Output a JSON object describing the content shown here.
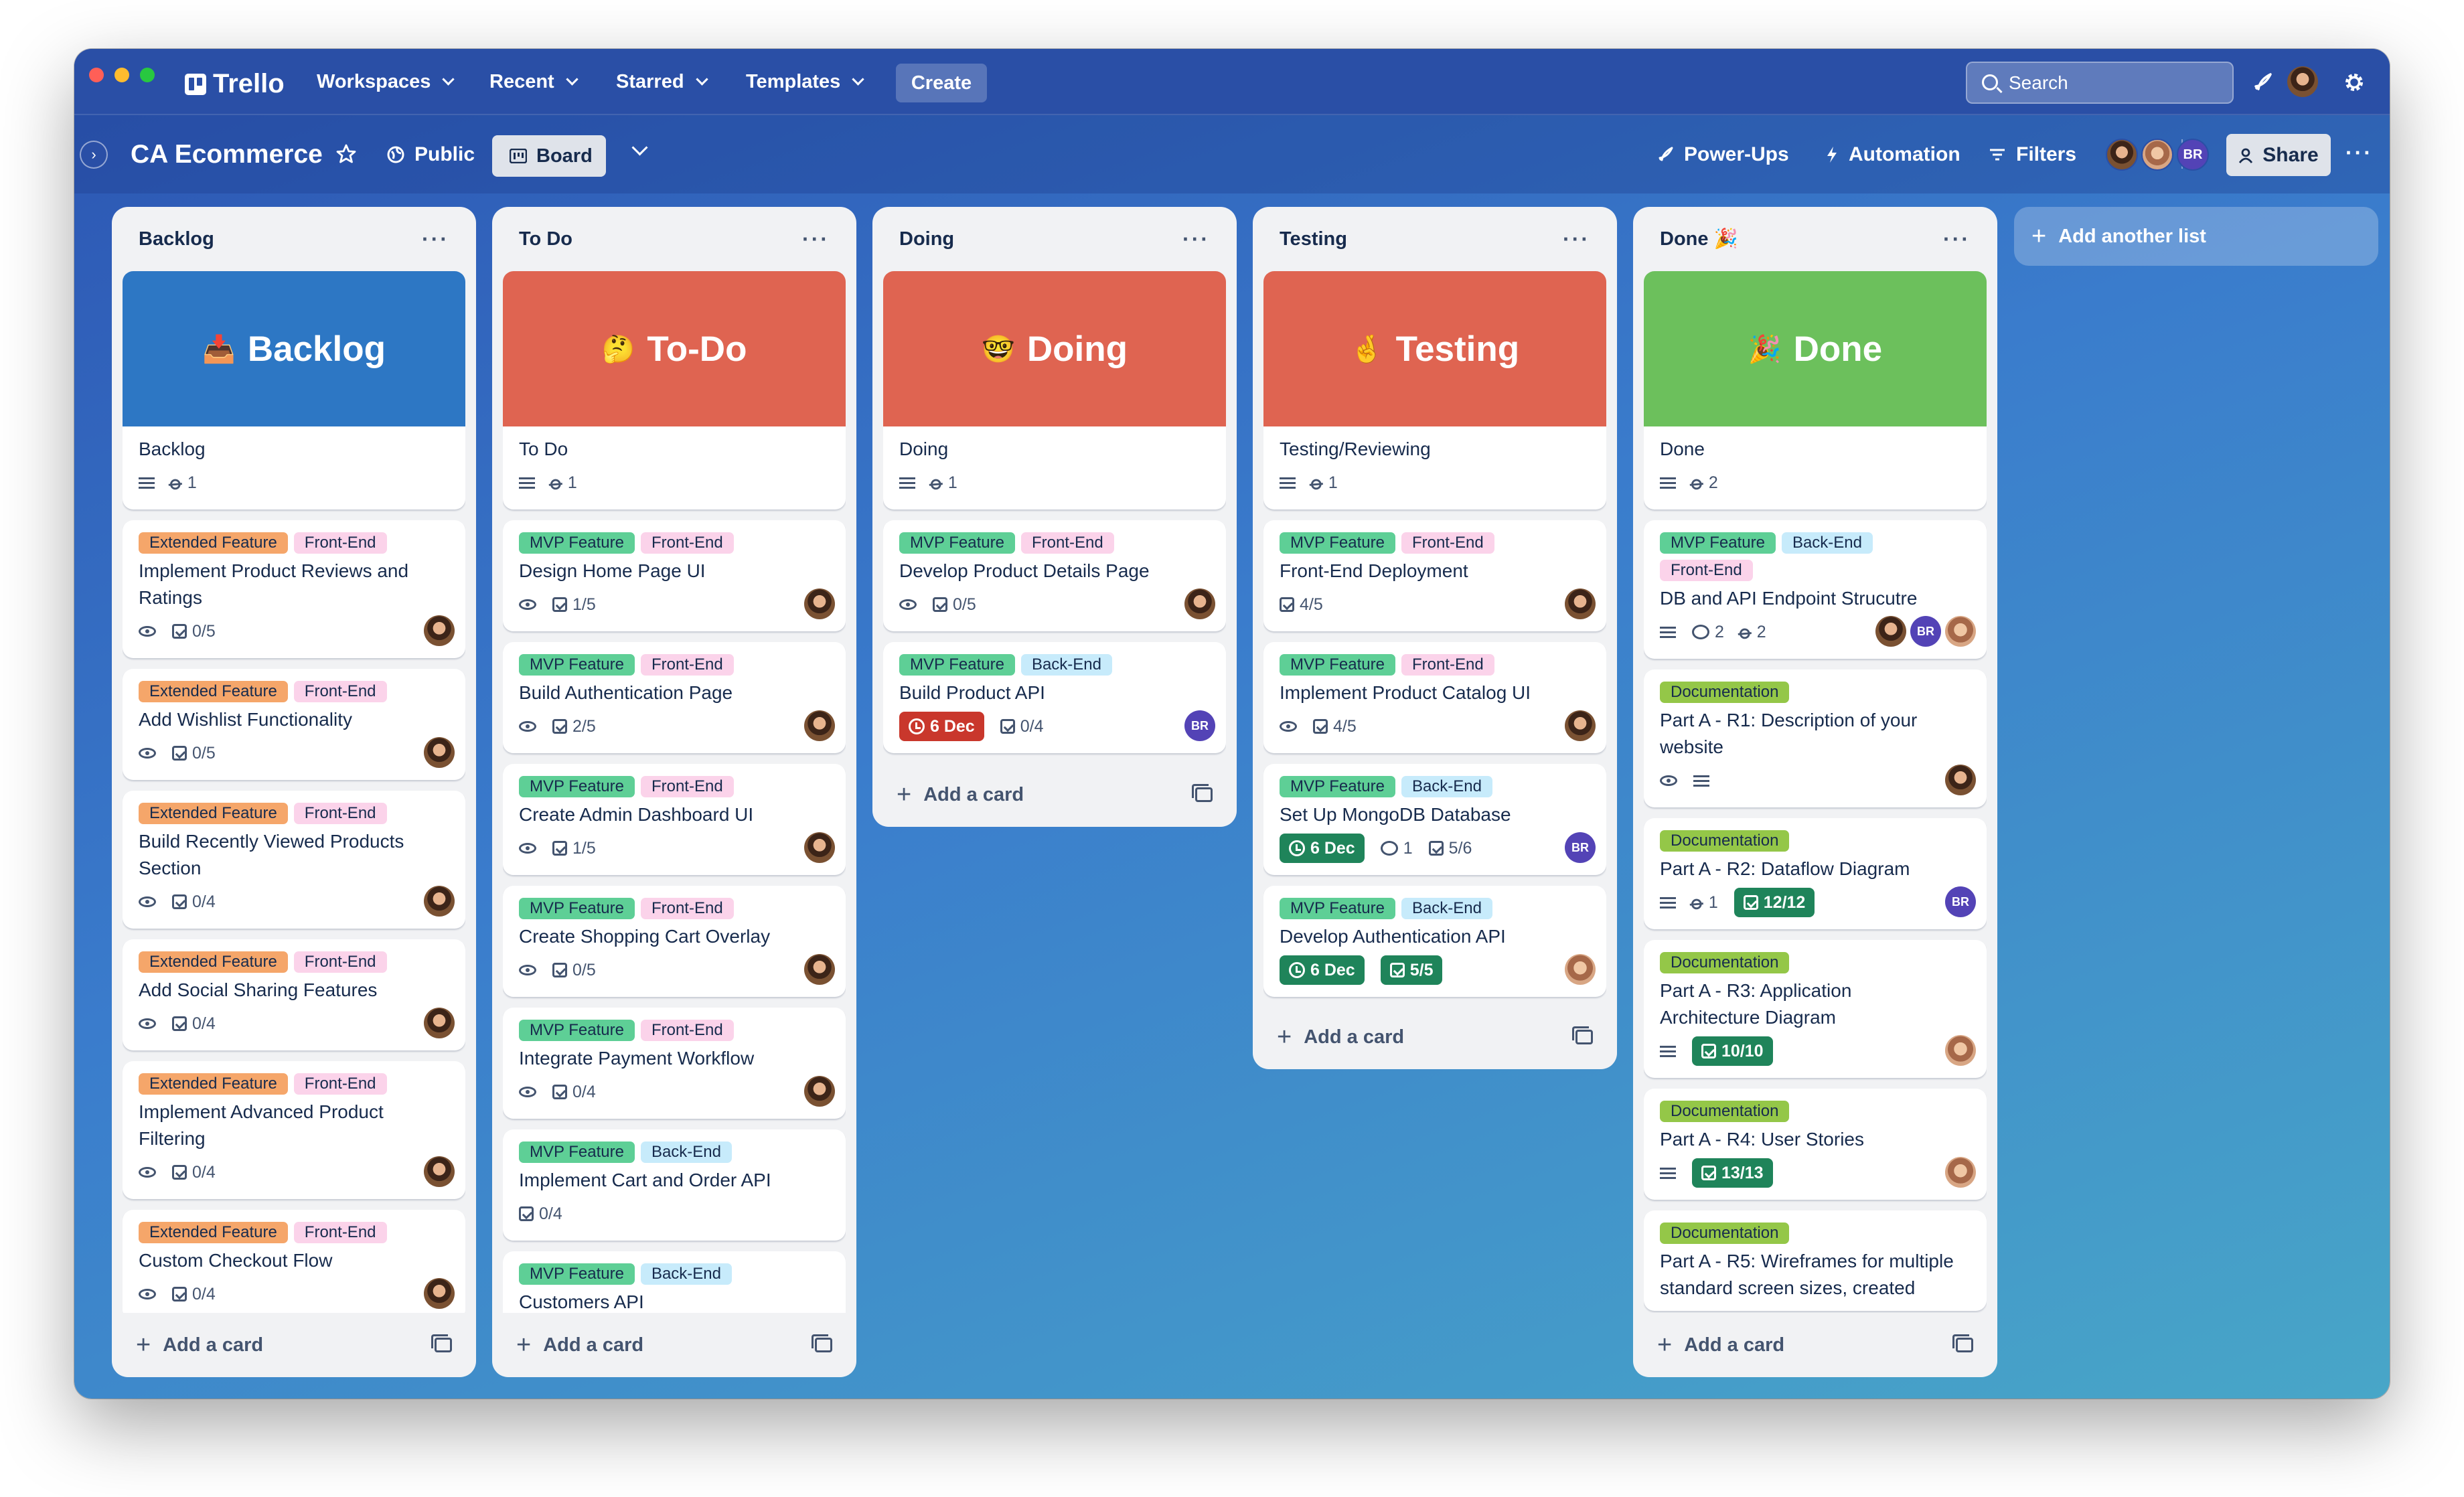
{
  "topbar": {
    "brand": "Trello",
    "nav": [
      "Workspaces",
      "Recent",
      "Starred",
      "Templates"
    ],
    "create": "Create",
    "search_placeholder": "Search"
  },
  "board": {
    "title": "CA Ecommerce",
    "visibility": "Public",
    "view": "Board",
    "powerups": "Power-Ups",
    "automation": "Automation",
    "filters": "Filters",
    "share": "Share",
    "member_initials": "BR"
  },
  "lists": [
    {
      "title": "Backlog",
      "cards": [
        {
          "cover": {
            "text": "Backlog",
            "emoji": "📥",
            "color": "#2d77c4"
          },
          "title": "Backlog",
          "badges": {
            "desc": true,
            "attach": "1"
          }
        },
        {
          "labels": [
            "Extended Feature",
            "Front-End"
          ],
          "title": [
            "Implement Product Reviews and",
            "Ratings"
          ],
          "badges": {
            "watch": true,
            "check": "0/5"
          },
          "avatars": [
            "photo"
          ]
        },
        {
          "labels": [
            "Extended Feature",
            "Front-End"
          ],
          "title": [
            "Add Wishlist Functionality"
          ],
          "badges": {
            "watch": true,
            "check": "0/5"
          },
          "avatars": [
            "photo"
          ]
        },
        {
          "labels": [
            "Extended Feature",
            "Front-End"
          ],
          "title": [
            "Build Recently Viewed Products",
            "Section"
          ],
          "badges": {
            "watch": true,
            "check": "0/4"
          },
          "avatars": [
            "photo"
          ]
        },
        {
          "labels": [
            "Extended Feature",
            "Front-End"
          ],
          "title": [
            "Add Social Sharing Features"
          ],
          "badges": {
            "watch": true,
            "check": "0/4"
          },
          "avatars": [
            "photo"
          ]
        },
        {
          "labels": [
            "Extended Feature",
            "Front-End"
          ],
          "title": [
            "Implement Advanced Product",
            "Filtering"
          ],
          "badges": {
            "watch": true,
            "check": "0/4"
          },
          "avatars": [
            "photo"
          ]
        },
        {
          "labels": [
            "Extended Feature",
            "Front-End"
          ],
          "title": [
            "Custom Checkout Flow"
          ],
          "badges": {
            "watch": true,
            "check": "0/4"
          },
          "avatars": [
            "photo"
          ]
        }
      ],
      "add": "Add a card"
    },
    {
      "title": "To Do",
      "cards": [
        {
          "cover": {
            "text": "To-Do",
            "emoji": "🤔",
            "color": "#df6451"
          },
          "title": "To Do",
          "badges": {
            "desc": true,
            "attach": "1"
          }
        },
        {
          "labels": [
            "MVP Feature",
            "Front-End"
          ],
          "title": [
            "Design Home Page UI"
          ],
          "badges": {
            "watch": true,
            "check": "1/5"
          },
          "avatars": [
            "photo"
          ]
        },
        {
          "labels": [
            "MVP Feature",
            "Front-End"
          ],
          "title": [
            "Build Authentication Page"
          ],
          "badges": {
            "watch": true,
            "check": "2/5"
          },
          "avatars": [
            "photo"
          ]
        },
        {
          "labels": [
            "MVP Feature",
            "Front-End"
          ],
          "title": [
            "Create Admin Dashboard UI"
          ],
          "badges": {
            "watch": true,
            "check": "1/5"
          },
          "avatars": [
            "photo"
          ]
        },
        {
          "labels": [
            "MVP Feature",
            "Front-End"
          ],
          "title": [
            "Create Shopping Cart Overlay"
          ],
          "badges": {
            "watch": true,
            "check": "0/5"
          },
          "avatars": [
            "photo"
          ]
        },
        {
          "labels": [
            "MVP Feature",
            "Front-End"
          ],
          "title": [
            "Integrate Payment Workflow"
          ],
          "badges": {
            "watch": true,
            "check": "0/4"
          },
          "avatars": [
            "photo"
          ]
        },
        {
          "labels": [
            "MVP Feature",
            "Back-End"
          ],
          "title": [
            "Implement Cart and Order API"
          ],
          "badges": {
            "check": "0/4"
          }
        },
        {
          "labels": [
            "MVP Feature",
            "Back-End"
          ],
          "title": [
            "Customers API"
          ],
          "badges": {}
        }
      ],
      "add": "Add a card"
    },
    {
      "title": "Doing",
      "cards": [
        {
          "cover": {
            "text": "Doing",
            "emoji": "🤓",
            "color": "#df6451"
          },
          "title": "Doing",
          "badges": {
            "desc": true,
            "attach": "1"
          }
        },
        {
          "labels": [
            "MVP Feature",
            "Front-End"
          ],
          "title": [
            "Develop Product Details Page"
          ],
          "badges": {
            "watch": true,
            "check": "0/5"
          },
          "avatars": [
            "photo"
          ]
        },
        {
          "labels": [
            "MVP Feature",
            "Back-End"
          ],
          "title": [
            "Build Product API"
          ],
          "badges": {
            "due": "6 Dec",
            "due_color": "#c9372c",
            "check": "0/4"
          },
          "avatars": [
            "br"
          ]
        }
      ],
      "add": "Add a card"
    },
    {
      "title": "Testing",
      "cards": [
        {
          "cover": {
            "text": "Testing",
            "emoji": "🤞",
            "color": "#df6451"
          },
          "title": "Testing/Reviewing",
          "badges": {
            "desc": true,
            "attach": "1"
          }
        },
        {
          "labels": [
            "MVP Feature",
            "Front-End"
          ],
          "title": [
            "Front-End Deployment"
          ],
          "badges": {
            "check": "4/5"
          },
          "avatars": [
            "photo"
          ]
        },
        {
          "labels": [
            "MVP Feature",
            "Front-End"
          ],
          "title": [
            "Implement Product Catalog UI"
          ],
          "badges": {
            "watch": true,
            "check": "4/5"
          },
          "avatars": [
            "photo"
          ]
        },
        {
          "labels": [
            "MVP Feature",
            "Back-End"
          ],
          "title": [
            "Set Up MongoDB Database"
          ],
          "badges": {
            "due": "6 Dec",
            "due_color": "#1f845a",
            "comments": "1",
            "check": "5/6"
          },
          "avatars": [
            "br"
          ]
        },
        {
          "labels": [
            "MVP Feature",
            "Back-End"
          ],
          "title": [
            "Develop Authentication API"
          ],
          "badges": {
            "due": "6 Dec",
            "due_color": "#1f845a",
            "check_chip": "5/5"
          },
          "avatars": [
            "photo2"
          ]
        }
      ],
      "add": "Add a card"
    },
    {
      "title": "Done 🎉",
      "cards": [
        {
          "cover": {
            "text": "Done",
            "emoji": "🎉",
            "color": "#6cc05c"
          },
          "title": "Done",
          "badges": {
            "desc": true,
            "attach": "2"
          }
        },
        {
          "labels": [
            "MVP Feature",
            "Back-End",
            "Front-End"
          ],
          "title": [
            "DB and API Endpoint Strucutre"
          ],
          "badges": {
            "desc": true,
            "comments": "2",
            "attach": "2"
          },
          "avatars": [
            "photo",
            "br",
            "photo2"
          ]
        },
        {
          "labels": [
            "Documentation"
          ],
          "title": [
            "Part A - R1: Description of your",
            "website"
          ],
          "badges": {
            "watch": true,
            "desc": true
          },
          "avatars": [
            "photo"
          ]
        },
        {
          "labels": [
            "Documentation"
          ],
          "title": [
            "Part A - R2: Dataflow Diagram"
          ],
          "badges": {
            "desc": true,
            "attach": "1",
            "check_chip": "12/12"
          },
          "avatars": [
            "br"
          ]
        },
        {
          "labels": [
            "Documentation"
          ],
          "title": [
            "Part A - R3: Application",
            "Architecture Diagram"
          ],
          "badges": {
            "desc": true,
            "check_chip": "10/10"
          },
          "avatars": [
            "photo2"
          ]
        },
        {
          "labels": [
            "Documentation"
          ],
          "title": [
            "Part A - R4: User Stories"
          ],
          "badges": {
            "desc": true,
            "check_chip": "13/13"
          },
          "avatars": [
            "photo2"
          ]
        },
        {
          "labels": [
            "Documentation"
          ],
          "title": [
            "Part A - R5: Wireframes for multiple",
            "standard screen sizes, created"
          ],
          "badges": {}
        }
      ],
      "add": "Add a card"
    }
  ],
  "add_list": "Add another list",
  "label_colors": {
    "Extended Feature": "#f5a66a",
    "Front-End": "#fbd3ea",
    "MVP Feature": "#5ecf96",
    "Back-End": "#c7ebfb",
    "Documentation": "#94c748"
  },
  "icons": [
    "search-icon",
    "bell-icon",
    "gear-icon",
    "star-icon",
    "globe-icon",
    "board-icon",
    "chevron-down-icon",
    "bolt-icon",
    "filter-icon",
    "rocket-icon",
    "eye-icon",
    "checklist-icon",
    "description-icon",
    "attachment-icon",
    "comment-icon",
    "clock-icon",
    "template-icon",
    "plus-icon"
  ]
}
